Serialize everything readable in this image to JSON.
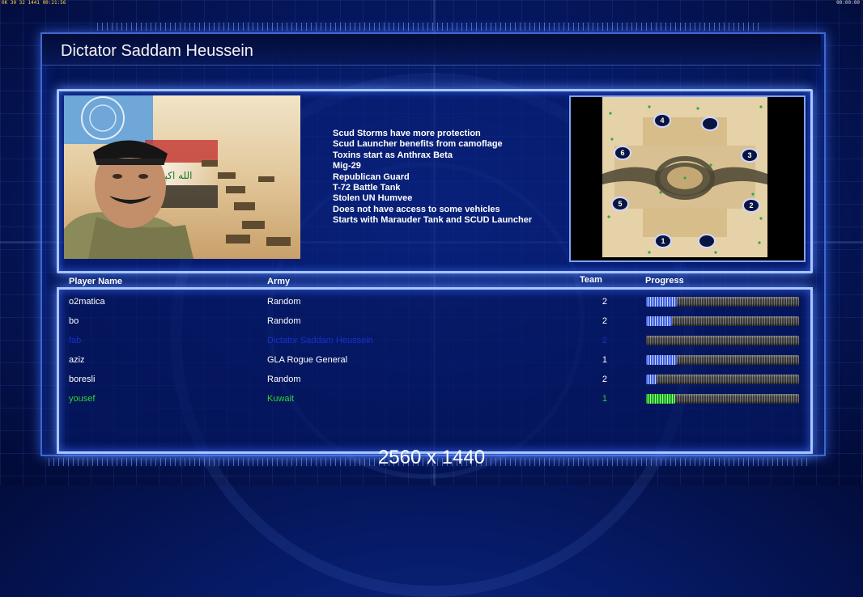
{
  "debug_bar": {
    "left_text": "0K 30 32 1441 00:21:56",
    "right_text": "00:00:00"
  },
  "title": "Dictator Saddam Heussein",
  "general": {
    "features": [
      "Scud Storms have more protection",
      "Scud Launcher benefits from camoflage",
      "Toxins start as Anthrax Beta",
      "Mig-29",
      "Republican Guard",
      "T-72 Battle Tank",
      "Stolen UN Humvee",
      "Does not have access to some vehicles",
      "Starts with Marauder Tank and SCUD Launcher"
    ]
  },
  "minimap": {
    "start_positions": [
      {
        "label": "4"
      },
      {
        "label": ""
      },
      {
        "label": "6"
      },
      {
        "label": "3"
      },
      {
        "label": "5"
      },
      {
        "label": "2"
      },
      {
        "label": "1"
      },
      {
        "label": ""
      }
    ]
  },
  "players": {
    "headers": {
      "name": "Player Name",
      "army": "Army",
      "team": "Team",
      "progress": "Progress"
    },
    "rows": [
      {
        "name": "o2matica",
        "army": "Random",
        "team": "2",
        "progress": 0.2,
        "color": "#ffffff",
        "bar_color": "blue"
      },
      {
        "name": "bo",
        "army": "Random",
        "team": "2",
        "progress": 0.17,
        "color": "#ffffff",
        "bar_color": "blue"
      },
      {
        "name": "fab",
        "army": "Dictator Saddam Heussein",
        "team": "2",
        "progress": 0.0,
        "color": "#1730d0",
        "bar_color": "blue"
      },
      {
        "name": "aziz",
        "army": "GLA Rogue General",
        "team": "1",
        "progress": 0.2,
        "color": "#ffffff",
        "bar_color": "blue"
      },
      {
        "name": "boresli",
        "army": "Random",
        "team": "2",
        "progress": 0.07,
        "color": "#ffffff",
        "bar_color": "blue"
      },
      {
        "name": "yousef",
        "army": "Kuwait",
        "team": "1",
        "progress": 0.19,
        "color": "#2fd52f",
        "bar_color": "green"
      }
    ]
  },
  "resolution": "2560 x 1440"
}
